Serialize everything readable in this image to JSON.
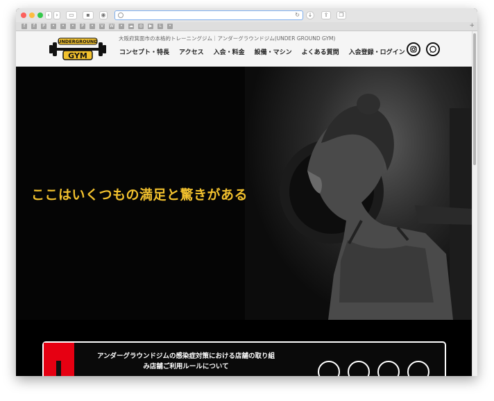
{
  "header": {
    "logo_text_top": "UNDERGROUND",
    "logo_text_bottom": "GYM",
    "tagline": "大阪府箕面市の本格的トレーニングジム｜アンダーグラウンドジム(UNDER GROUND GYM)",
    "nav": [
      {
        "label": "コンセプト・特長"
      },
      {
        "label": "アクセス"
      },
      {
        "label": "入会・料金"
      },
      {
        "label": "設備・マシン"
      },
      {
        "label": "よくある質問"
      },
      {
        "label": "入会登録・ログイン"
      }
    ],
    "social": [
      {
        "icon": "instagram-icon"
      },
      {
        "icon": "whatsapp-icon"
      }
    ]
  },
  "hero": {
    "title": "ここはいくつもの満足と驚きがある"
  },
  "notice": {
    "line1": "アンダーグラウンドジムの感染症対策における店舗の取り組",
    "line2": "み店舗ご利用ルールについて",
    "icons": [
      "mask-icon",
      "sanitizer-icon",
      "hand-wash-icon",
      "ventilation-icon"
    ]
  },
  "colors": {
    "accent": "#f2c12e",
    "notice_red": "#e60012",
    "header_bg": "#f5f5f5"
  }
}
